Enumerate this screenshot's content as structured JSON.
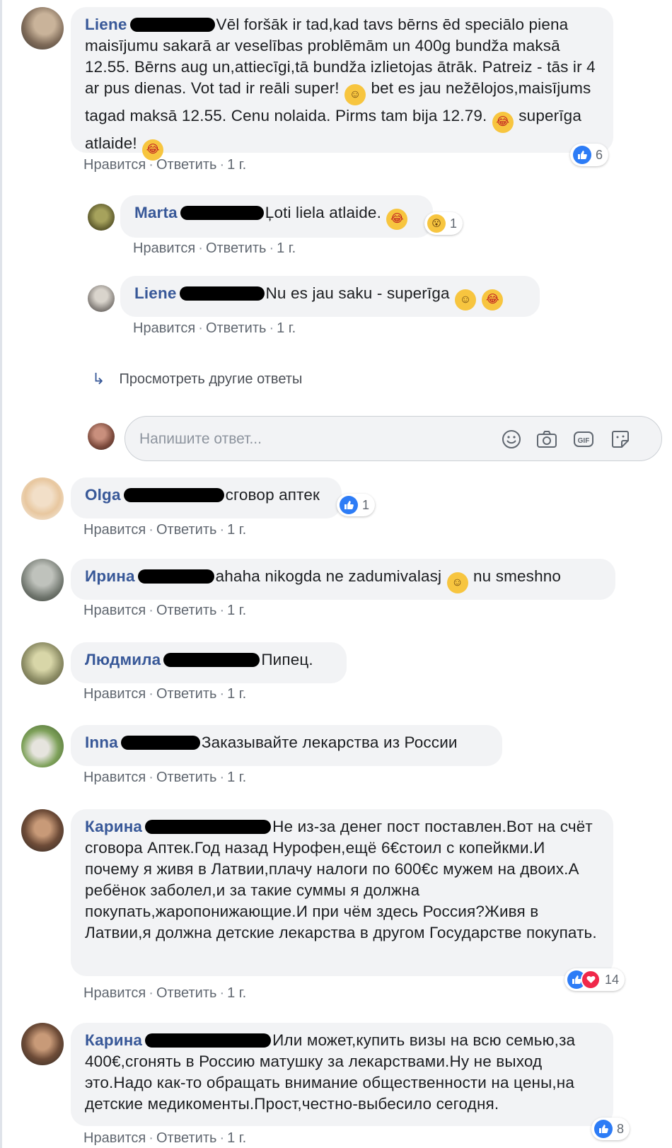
{
  "actions": {
    "like": "Нравится",
    "reply": "Ответить",
    "sep": "·",
    "time": "1 г."
  },
  "more_replies": "Просмотреть другие ответы",
  "composer": {
    "placeholder": "Напишите ответ..."
  },
  "comments": [
    {
      "name": "Liene",
      "text": "Vēl foršāk ir tad,kad tavs bērns ēd speciālo piena maisījumu sakarā ar veselības problēmām un 400g bundža maksā 12.55. Bērns aug un,attiecīgi,tā bundža izlietojas ātrāk. Patreiz - tās ir 4 ar pus dienas. Vot tad ir reāli super!",
      "text2": "bet es jau nežēlojos,maisījums tagad maksā 12.55. Cenu nolaida. Pirms tam bija 12.79.",
      "text3": "superīga atlaide!",
      "reactions": "6"
    },
    {
      "name": "Marta",
      "text": "Ļoti liela atlaide.",
      "reactions": "1"
    },
    {
      "name": "Liene",
      "text": "Nu es jau saku - superīga"
    },
    {
      "name": "Olga",
      "text": "сговор аптек",
      "reactions": "1"
    },
    {
      "name": "Ирина",
      "text": "ahaha nikogda ne zadumivalasj",
      "text2": "nu smeshno"
    },
    {
      "name": "Людмила",
      "text": "Пипец."
    },
    {
      "name": "Inna",
      "text": "Заказывайте лекарства из России"
    },
    {
      "name": "Карина",
      "text": "Не из-за денег пост поставлен.Вот на счёт сговора Аптек.Год назад Нурофен,ещё 6€стоил с копейкми.И почему я живя в Латвии,плачу налоги по 600€с мужем на двоих.А ребёнок заболел,и за такие суммы я должна покупать,жаропонижающие.И при чём здесь Россия?Живя в Латвии,я должна детские лекарства в другом Государстве покупать.",
      "reactions": "14"
    },
    {
      "name": "Карина",
      "text": "Или может,купить визы на всю семью,за 400€,сгонять в Россию матушку за лекарствами.Ну не выход это.Надо как-то обращать внимание общественности на цены,на детские медикоменты.Прост,честно-выбесило сегодня.",
      "reactions": "8"
    }
  ]
}
